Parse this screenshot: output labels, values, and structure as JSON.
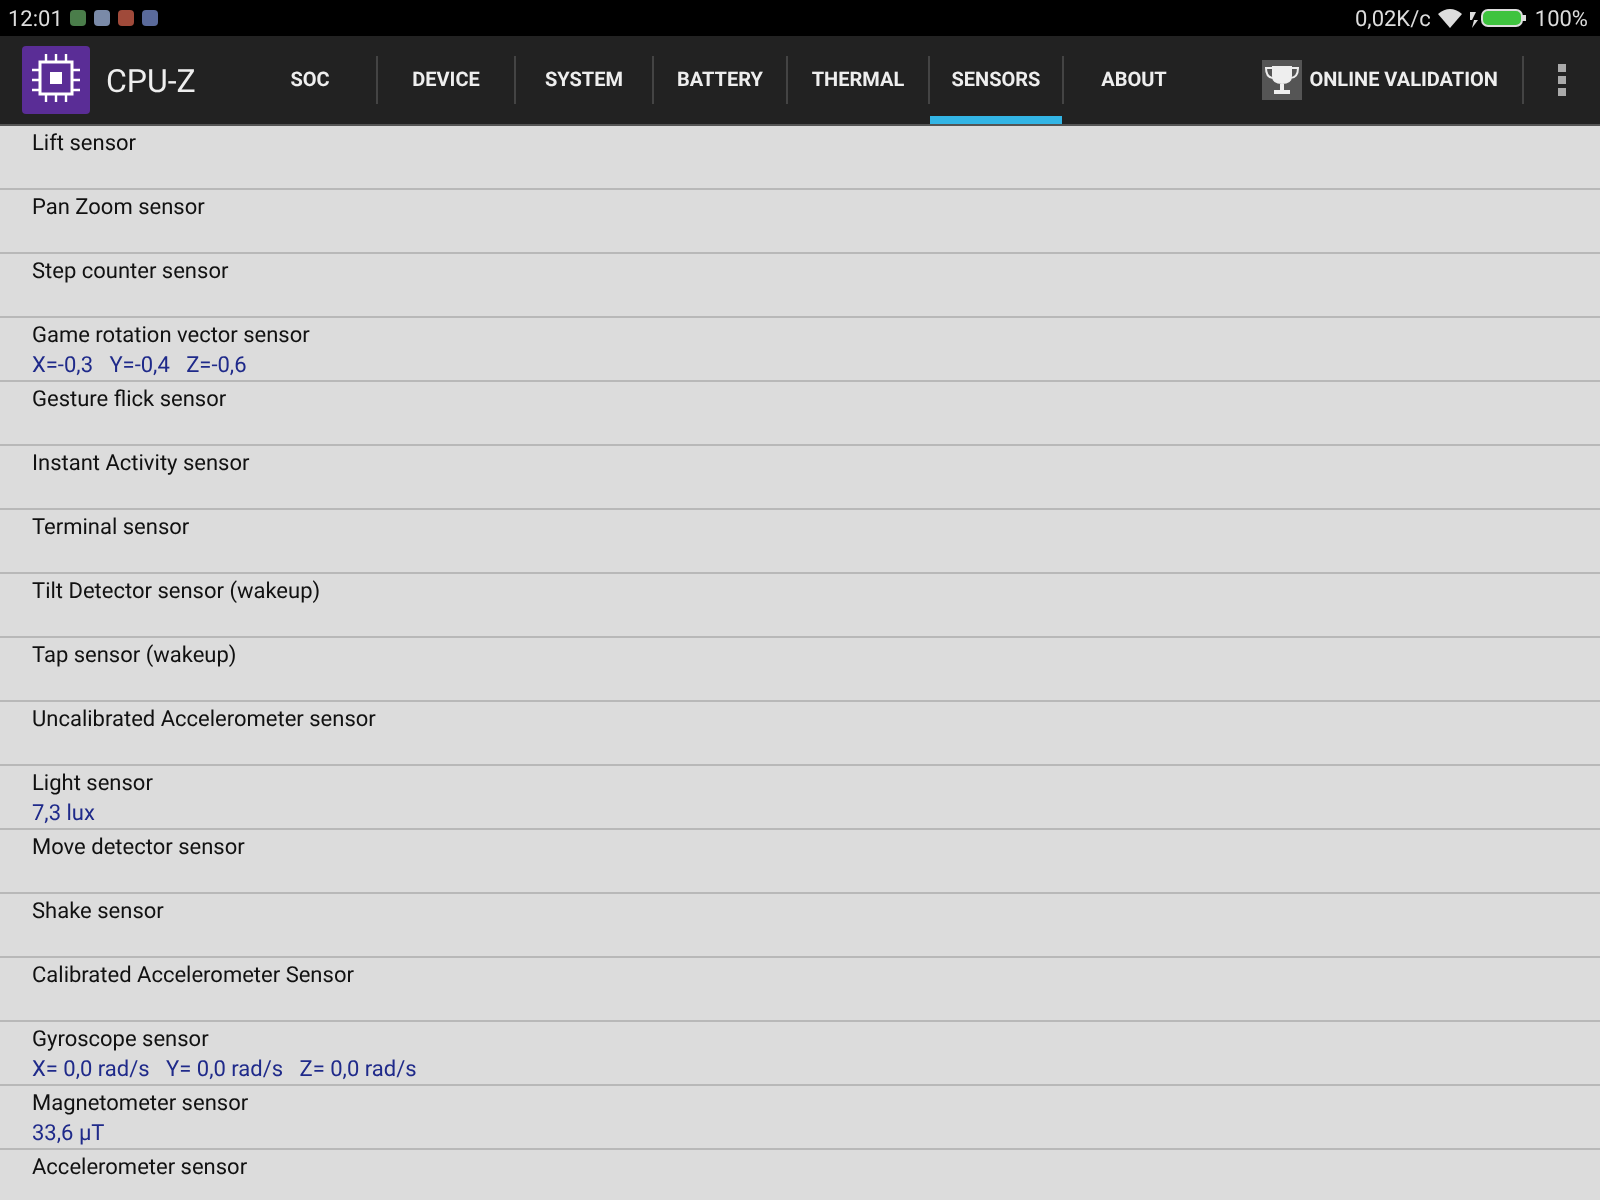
{
  "status_bar": {
    "time": "12:01",
    "speed": "0,02K/c",
    "battery": "100%"
  },
  "app": {
    "title": "CPU-Z"
  },
  "tabs": [
    {
      "label": "SOC",
      "selected": false
    },
    {
      "label": "DEVICE",
      "selected": false
    },
    {
      "label": "SYSTEM",
      "selected": false
    },
    {
      "label": "BATTERY",
      "selected": false
    },
    {
      "label": "THERMAL",
      "selected": false
    },
    {
      "label": "SENSORS",
      "selected": true
    },
    {
      "label": "ABOUT",
      "selected": false
    }
  ],
  "validation_button": "ONLINE VALIDATION",
  "sensors": [
    {
      "name": "Lift sensor"
    },
    {
      "name": "Pan Zoom sensor"
    },
    {
      "name": "Step counter sensor"
    },
    {
      "name": "Game rotation vector sensor",
      "reading": "X=-0,3   Y=-0,4   Z=-0,6"
    },
    {
      "name": "Gesture flick sensor"
    },
    {
      "name": "Instant Activity sensor"
    },
    {
      "name": "Terminal sensor"
    },
    {
      "name": "Tilt Detector sensor (wakeup)"
    },
    {
      "name": "Tap sensor (wakeup)"
    },
    {
      "name": "Uncalibrated Accelerometer sensor"
    },
    {
      "name": "Light sensor",
      "reading": "7,3 lux"
    },
    {
      "name": "Move detector sensor"
    },
    {
      "name": "Shake sensor"
    },
    {
      "name": "Calibrated Accelerometer Sensor"
    },
    {
      "name": "Gyroscope sensor",
      "reading": "X= 0,0 rad/s   Y= 0,0 rad/s   Z= 0,0 rad/s"
    },
    {
      "name": "Magnetometer sensor",
      "reading": "33,6 µT"
    },
    {
      "name": "Accelerometer sensor"
    }
  ]
}
